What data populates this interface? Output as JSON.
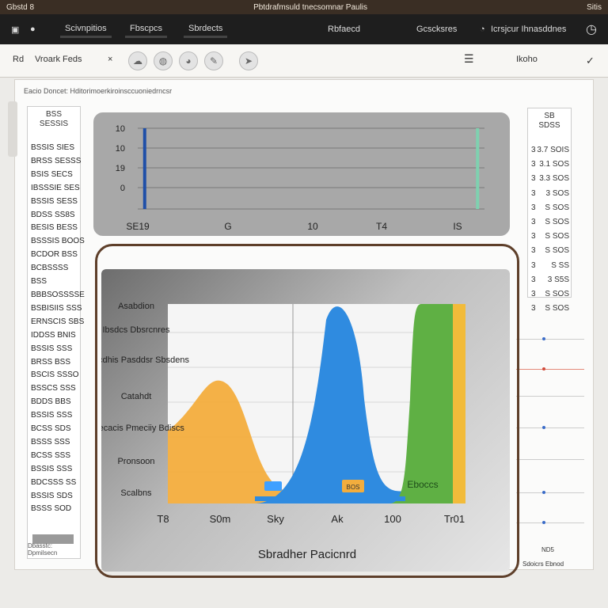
{
  "window": {
    "title": "Pbtdrafmsuld tnecsomnar Paulis",
    "left_label": "Gbstd 8",
    "right_label": "Sitis"
  },
  "menubar": {
    "tabs": [
      "Scivnpitios",
      "Fbscpcs",
      "Sbrdects"
    ],
    "right_items": [
      "Rbfaecd",
      "Gcscksres",
      "Icrsjcur Ihnasddnes"
    ]
  },
  "toolbar": {
    "left_label": "Rd",
    "path_label": "Vroark Feds",
    "right_label": "Ikoho"
  },
  "breadcrumb": "Eacio Doncet: Hditorimoerkiroinsccuoniedrncsr",
  "left_column": {
    "header": "BSS\nSESSIS",
    "rows": [
      "BSSIS SIES",
      "BRSS SESSS",
      "BSIS SECS",
      "IBSSSIE SES",
      "BSSIS SESS",
      "BDSS SS8S",
      "BESIS BESS",
      "BSSSIS BOOS",
      "BCDOR BSS",
      "BCBSSSS BSS",
      "BBBSOSSSSE",
      "BSBISIIS SSS",
      "ERNSCIS SBS",
      "IDDSS BNIS",
      "BSSIS SSS",
      "BRSS BSS",
      "BSCIS SSSO",
      "BSSCS SSS",
      "BDDS BBS",
      "BSSIS SSS",
      "BCSS SDS",
      "BSSS SSS",
      "BCSS SSS",
      "BSSIS SSS",
      "BDCSSS SS",
      "BSSIS SDS",
      "BSSS SOD"
    ],
    "footer": "Dbasstc: Dpmilsecn"
  },
  "right_column": {
    "header": "SB\nSDSS",
    "rows": [
      [
        "3",
        "3.7 SOIS"
      ],
      [
        "3",
        "3.1 SOS"
      ],
      [
        "3",
        "3.3 SOS"
      ],
      [
        "3",
        "3 SOS"
      ],
      [
        "3",
        "S SOS"
      ],
      [
        "3",
        "S SOS"
      ],
      [
        "3",
        "S SOS"
      ],
      [
        "3",
        "S SOS"
      ],
      [
        "3",
        "S SS"
      ],
      [
        "3",
        "3 S5S"
      ],
      [
        "3",
        "S SOS"
      ],
      [
        "3",
        "S SOS"
      ]
    ],
    "footer": "ND5",
    "footer2": "Sdoicrs Ebnod"
  },
  "chart_data": [
    {
      "type": "line",
      "title": "",
      "ylabels": [
        "10",
        "10",
        "19",
        "0"
      ],
      "xlabels": [
        "SE19",
        "G",
        "10",
        "T4",
        "IS"
      ],
      "series": [
        {
          "color": "#1f4fa8",
          "points": [
            [
              0.02,
              0
            ],
            [
              0.02,
              1
            ]
          ]
        },
        {
          "color": "#7fd1b0",
          "points": [
            [
              0.98,
              0
            ],
            [
              0.98,
              1
            ]
          ]
        }
      ]
    },
    {
      "type": "area",
      "title": "Sbradher Pacicnrd",
      "ylabels": [
        "Asabdion",
        "Ibsdcs Dbsrcnres",
        "Bsdcdhis Pasddsr Sbsdens",
        "Catahdt",
        "Ebecacis Pmeciiy Bdiscs",
        "Pronsoon",
        "Scalbns"
      ],
      "xlabels": [
        "T8",
        "S0m",
        "Sky",
        "Ak",
        "100",
        "Tr01"
      ],
      "series": [
        {
          "name": "Orange",
          "color": "#f3ad3d"
        },
        {
          "name": "Blue",
          "color": "#2f8be0"
        },
        {
          "name": "Green",
          "color": "#5fb044"
        },
        {
          "name": "Yellow",
          "color": "#f2bb3a"
        }
      ],
      "badges": [
        "Eboccs",
        "BOS"
      ],
      "badge_label": "Ebocacs"
    }
  ]
}
